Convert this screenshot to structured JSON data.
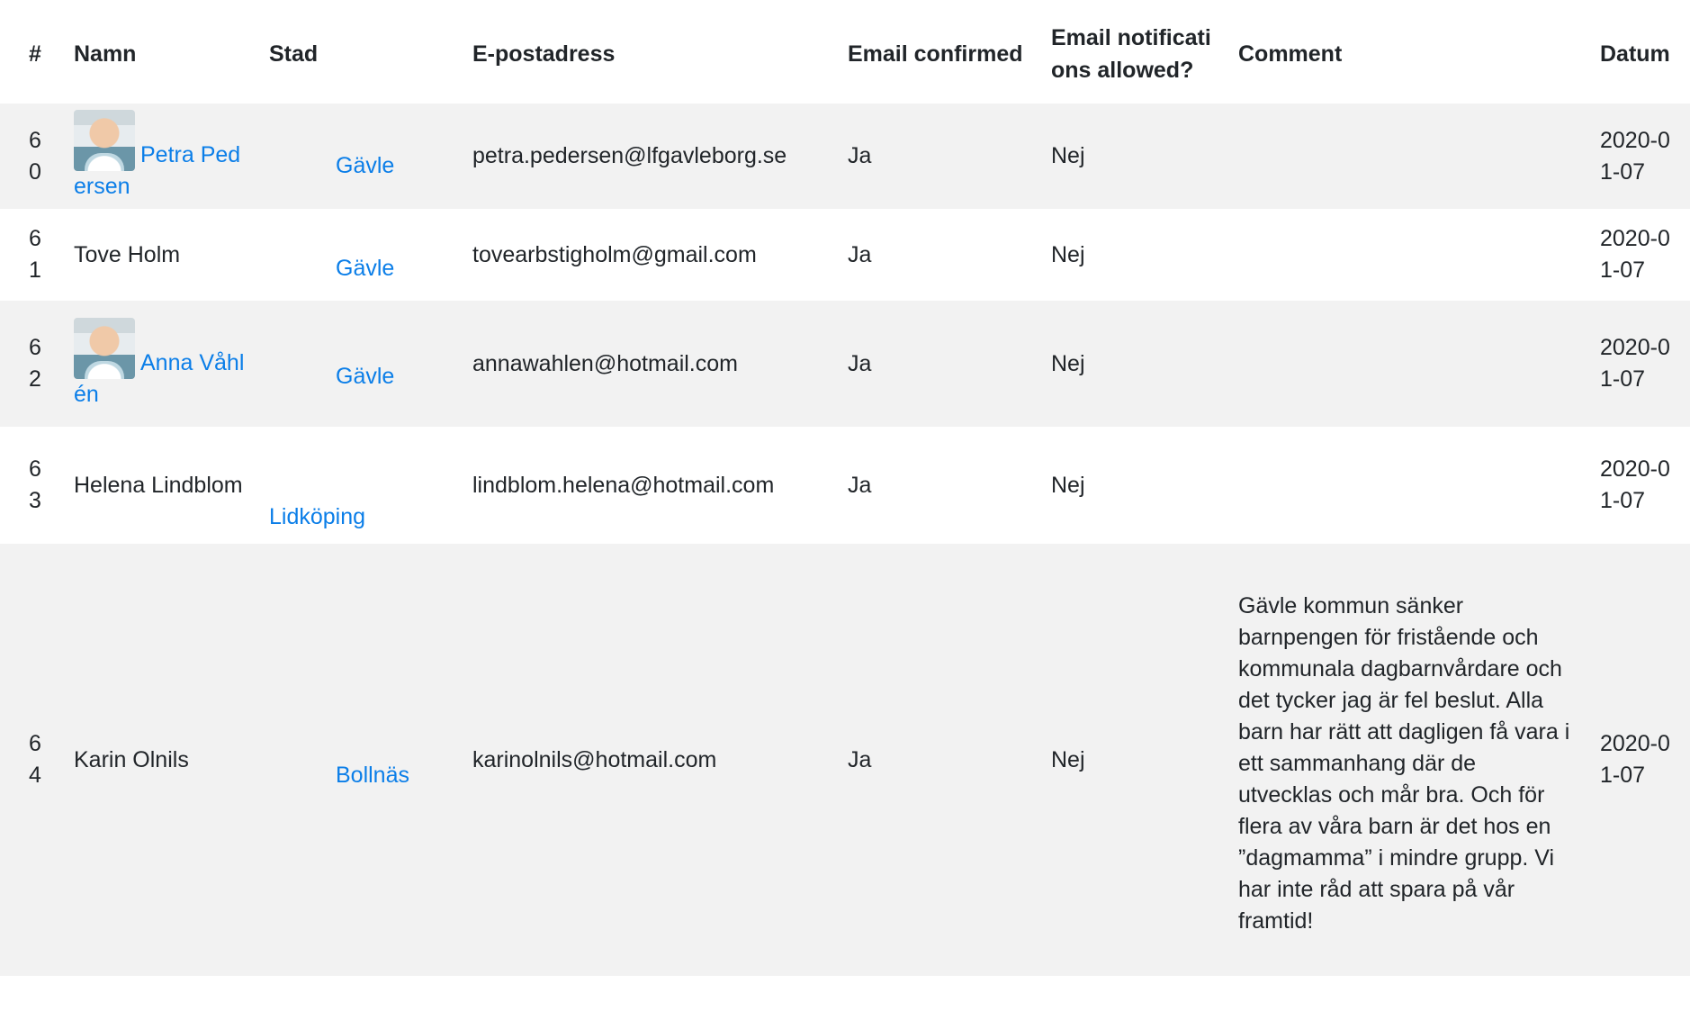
{
  "table": {
    "headers": {
      "num": "#",
      "name": "Namn",
      "city": "Stad",
      "email": "E-postadress",
      "email_confirmed": "Email confirmed",
      "notifications": "Email notifications allowed?",
      "comment": "Comment",
      "date": "Datum"
    },
    "rows": [
      {
        "num": "60",
        "name": "Petra Pedersen",
        "name_is_link": true,
        "has_avatar": true,
        "city": "Gävle",
        "email": "petra.pedersen@lfgavleborg.se",
        "email_confirmed": "Ja",
        "notifications": "Nej",
        "comment": "",
        "date": "2020-01-07"
      },
      {
        "num": "61",
        "name": "Tove Holm",
        "name_is_link": false,
        "has_avatar": false,
        "city": "Gävle",
        "email": "tovearbstigholm@gmail.com",
        "email_confirmed": "Ja",
        "notifications": "Nej",
        "comment": "",
        "date": "2020-01-07"
      },
      {
        "num": "62",
        "name": "Anna Våhlén",
        "name_is_link": true,
        "has_avatar": true,
        "city": "Gävle",
        "email": "annawahlen@hotmail.com",
        "email_confirmed": "Ja",
        "notifications": "Nej",
        "comment": "",
        "date": "2020-01-07"
      },
      {
        "num": "63",
        "name": "Helena Lindblom",
        "name_is_link": false,
        "has_avatar": false,
        "city": "Lidköping",
        "email": "lindblom.helena@hotmail.com",
        "email_confirmed": "Ja",
        "notifications": "Nej",
        "comment": "",
        "date": "2020-01-07"
      },
      {
        "num": "64",
        "name": "Karin Olnils",
        "name_is_link": false,
        "has_avatar": false,
        "city": "Bollnäs",
        "email": "karinolnils@hotmail.com",
        "email_confirmed": "Ja",
        "notifications": "Nej",
        "comment": "Gävle kommun sänker barnpengen för fristående och kommunala dagbarnvårdare och det tycker jag är fel beslut. Alla barn har rätt att dagligen få vara i ett sammanhang där de utvecklas och mår bra. Och för flera av våra barn är det hos en ”dagmamma” i mindre grupp. Vi har inte råd att spara på vår framtid!",
        "date": "2020-01-07"
      }
    ]
  }
}
